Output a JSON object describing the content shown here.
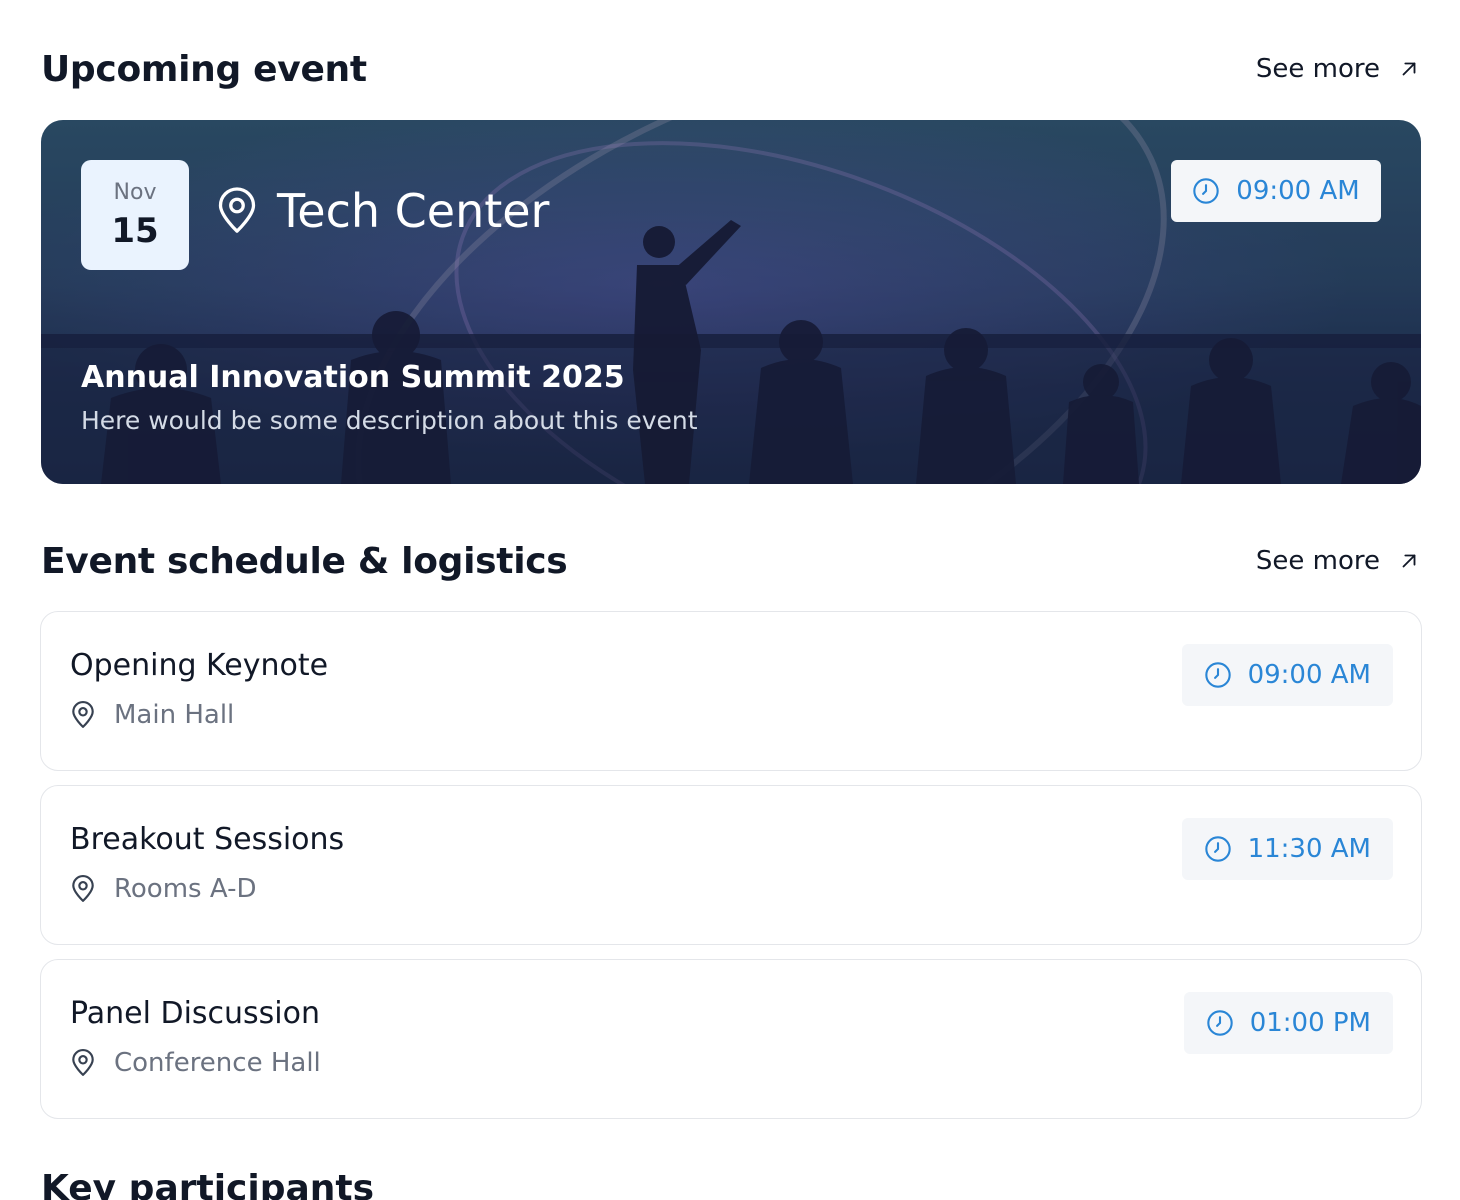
{
  "upcoming": {
    "section_title": "Upcoming event",
    "see_more_label": "See more",
    "event": {
      "month": "Nov",
      "day": "15",
      "location": "Tech Center",
      "time": "09:00 AM",
      "title": "Annual Innovation Summit 2025",
      "description": "Here would be some description about this event"
    }
  },
  "schedule": {
    "section_title": "Event schedule & logistics",
    "see_more_label": "See more",
    "items": [
      {
        "title": "Opening Keynote",
        "location": "Main Hall",
        "time": "09:00 AM"
      },
      {
        "title": "Breakout Sessions",
        "location": "Rooms A-D",
        "time": "11:30 AM"
      },
      {
        "title": "Panel Discussion",
        "location": "Conference Hall",
        "time": "01:00 PM"
      }
    ]
  },
  "participants": {
    "section_title": "Key participants"
  },
  "colors": {
    "accent": "#2a86d6",
    "text_primary": "#111827",
    "text_secondary": "#6b7280",
    "time_badge_bg": "#f4f6f9",
    "date_box_bg": "#eaf3fe"
  },
  "icons": {
    "see_more": "arrow-up-right-icon",
    "location": "map-pin-icon",
    "time": "clock-icon"
  }
}
